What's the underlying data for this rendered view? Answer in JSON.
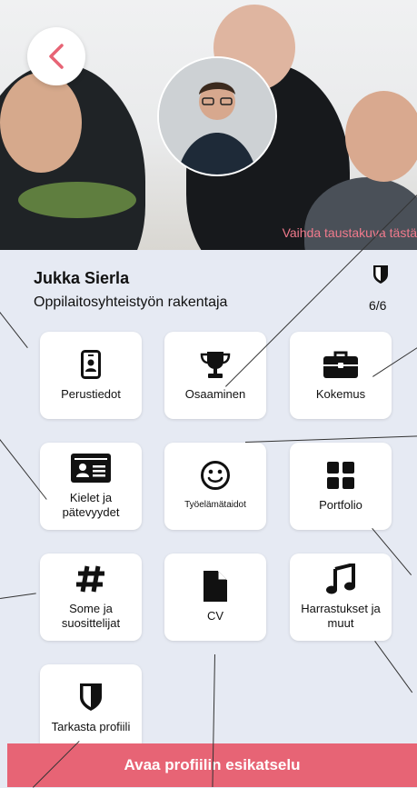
{
  "header": {
    "change_background_label": "Vaihda taustakuva tästä"
  },
  "profile": {
    "name": "Jukka Sierla",
    "title": "Oppilaitosyhteistyön rakentaja",
    "progress": "6/6"
  },
  "tiles": {
    "basic_info": "Perustiedot",
    "skills": "Osaaminen",
    "experience": "Kokemus",
    "languages_line1": "Kielet ja",
    "languages_line2": "pätevyydet",
    "working_skills": "Työelämätaidot",
    "portfolio": "Portfolio",
    "social_line1": "Some ja",
    "social_line2": "suosittelijat",
    "cv": "CV",
    "hobbies_line1": "Harrastukset ja",
    "hobbies_line2": "muut",
    "check_profile": "Tarkasta profiili"
  },
  "footer": {
    "preview_label": "Avaa profiilin esikatselu"
  },
  "colors": {
    "accent": "#e76475",
    "link": "#f07a8c",
    "background": "#e6eaf3"
  }
}
